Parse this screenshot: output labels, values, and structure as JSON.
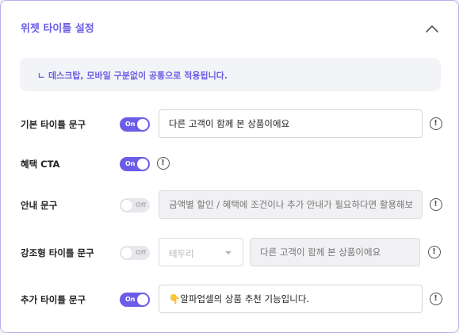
{
  "panel": {
    "title": "위젯 타이틀 설정",
    "collapse_icon": "chevron-up-icon",
    "notice": "ㄴ 데스크탑, 모바일 구분없이 공통으로 적용됩니다."
  },
  "colors": {
    "accent": "#6c5ce7",
    "panel_border": "#b9b1ee",
    "notice_bg": "#f3f4f7",
    "toggle_off": "#e8e8ec"
  },
  "toggle_labels": {
    "on": "On",
    "off": "Off"
  },
  "info_icon": {
    "name": "info-icon",
    "glyph": "!"
  },
  "rows": [
    {
      "label": "기본 타이틀 문구",
      "toggle": "on",
      "input_value": "다른 고객이 함께 본 상품이에요"
    },
    {
      "label": "혜택 CTA",
      "toggle": "on"
    },
    {
      "label": "안내 문구",
      "toggle": "off",
      "input_placeholder": "금액별 할인 / 혜택에 조건이나 추가 안내가 필요하다면 활용해보세요!"
    },
    {
      "label": "강조형 타이틀 문구",
      "toggle": "off",
      "select_value": "테두리",
      "input_placeholder": "다른 고객이 함께 본 상품이에요"
    },
    {
      "label": "추가 타이틀 문구",
      "toggle": "on",
      "input_value": "👇알파업셀의 상품 추천 기능입니다."
    }
  ]
}
